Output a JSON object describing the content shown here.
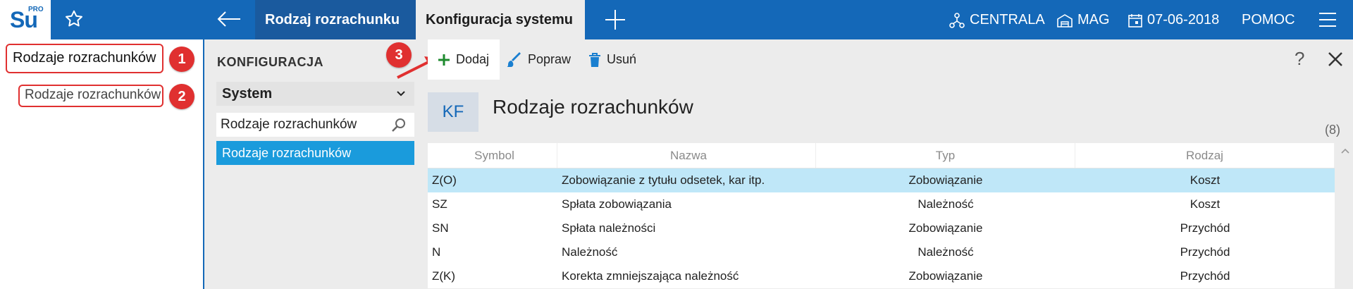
{
  "app": {
    "logo_text": "Su",
    "logo_pro": "PRO"
  },
  "tabs": [
    {
      "label": "Rodzaj rozrachunku"
    },
    {
      "label": "Konfiguracja systemu"
    }
  ],
  "header": {
    "centrala": "CENTRALA",
    "mag": "MAG",
    "date": "07-06-2018",
    "help": "POMOC"
  },
  "left_search": {
    "value": "Rodzaje rozrachunków",
    "result": "Rodzaje rozrachunków"
  },
  "annotations": [
    "1",
    "2",
    "3"
  ],
  "nav": {
    "title": "KONFIGURACJA",
    "select_value": "System",
    "search_value": "Rodzaje rozrachunków",
    "selected_item": "Rodzaje rozrachunków"
  },
  "toolbar": {
    "add": "Dodaj",
    "edit": "Popraw",
    "delete": "Usuń",
    "help": "?"
  },
  "main": {
    "badge": "KF",
    "title": "Rodzaje rozrachunków",
    "count": "(8)"
  },
  "table": {
    "columns": [
      "Symbol",
      "Nazwa",
      "Typ",
      "Rodzaj"
    ],
    "rows": [
      {
        "symbol": "Z(O)",
        "nazwa": "Zobowiązanie z tytułu odsetek, kar itp.",
        "typ": "Zobowiązanie",
        "rodzaj": "Koszt",
        "selected": true
      },
      {
        "symbol": "SZ",
        "nazwa": "Spłata zobowiązania",
        "typ": "Należność",
        "rodzaj": "Koszt"
      },
      {
        "symbol": "SN",
        "nazwa": "Spłata należności",
        "typ": "Zobowiązanie",
        "rodzaj": "Przychód"
      },
      {
        "symbol": "N",
        "nazwa": "Należność",
        "typ": "Należność",
        "rodzaj": "Przychód"
      },
      {
        "symbol": "Z(K)",
        "nazwa": "Korekta zmniejszająca należność",
        "typ": "Zobowiązanie",
        "rodzaj": "Przychód"
      }
    ]
  },
  "colors": {
    "primary": "#1468b8",
    "selected_nav": "#1a9bdc",
    "selected_row": "#bfe7f8",
    "annotation": "#e03030"
  }
}
